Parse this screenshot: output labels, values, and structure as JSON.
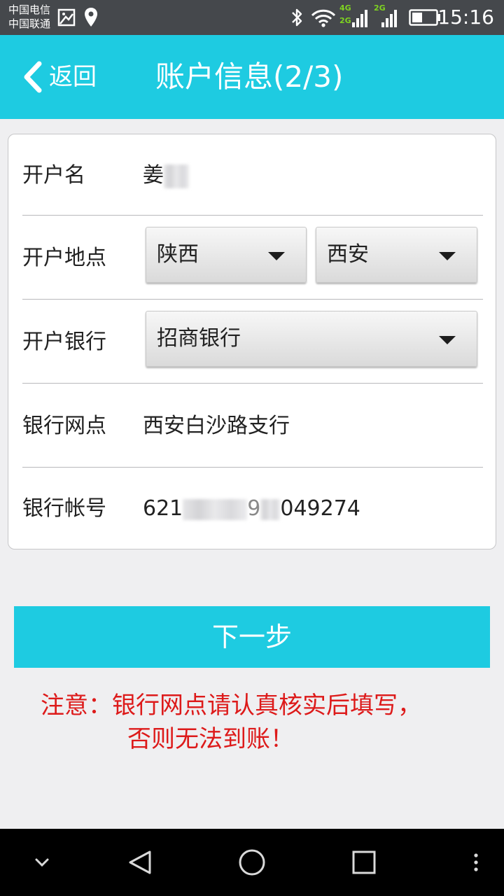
{
  "status_bar": {
    "carrier_1": "中国电信",
    "carrier_2": "中国联通",
    "network_1": "4G",
    "network_2": "2G",
    "network_3": "2G",
    "time": "15:16"
  },
  "header": {
    "back_label": "返回",
    "title": "账户信息(2/3)"
  },
  "form": {
    "account_name": {
      "label": "开户名",
      "value": "姜"
    },
    "location": {
      "label": "开户地点",
      "province": "陕西",
      "city": "西安"
    },
    "bank": {
      "label": "开户银行",
      "value": "招商银行"
    },
    "branch": {
      "label": "银行网点",
      "value": "西安白沙路支行"
    },
    "account_number": {
      "label": "银行帐号",
      "value_prefix": "621",
      "value_mid": "9",
      "value_suffix": "049274"
    }
  },
  "next_button": {
    "label": "下一步"
  },
  "notice": {
    "line_1": "注意：银行网点请认真核实后填写，",
    "line_2": "否则无法到账！"
  },
  "colors": {
    "accent": "#1ecbe1",
    "notice_red": "#dd1a1a",
    "status_bar": "#45484c"
  },
  "icons": {
    "back": "chevron-left-icon",
    "select": "triangle-down-icon",
    "nav_back": "triangle-left-icon",
    "nav_home": "circle-icon",
    "nav_recents": "square-icon",
    "nav_menu": "more-vertical-icon"
  }
}
